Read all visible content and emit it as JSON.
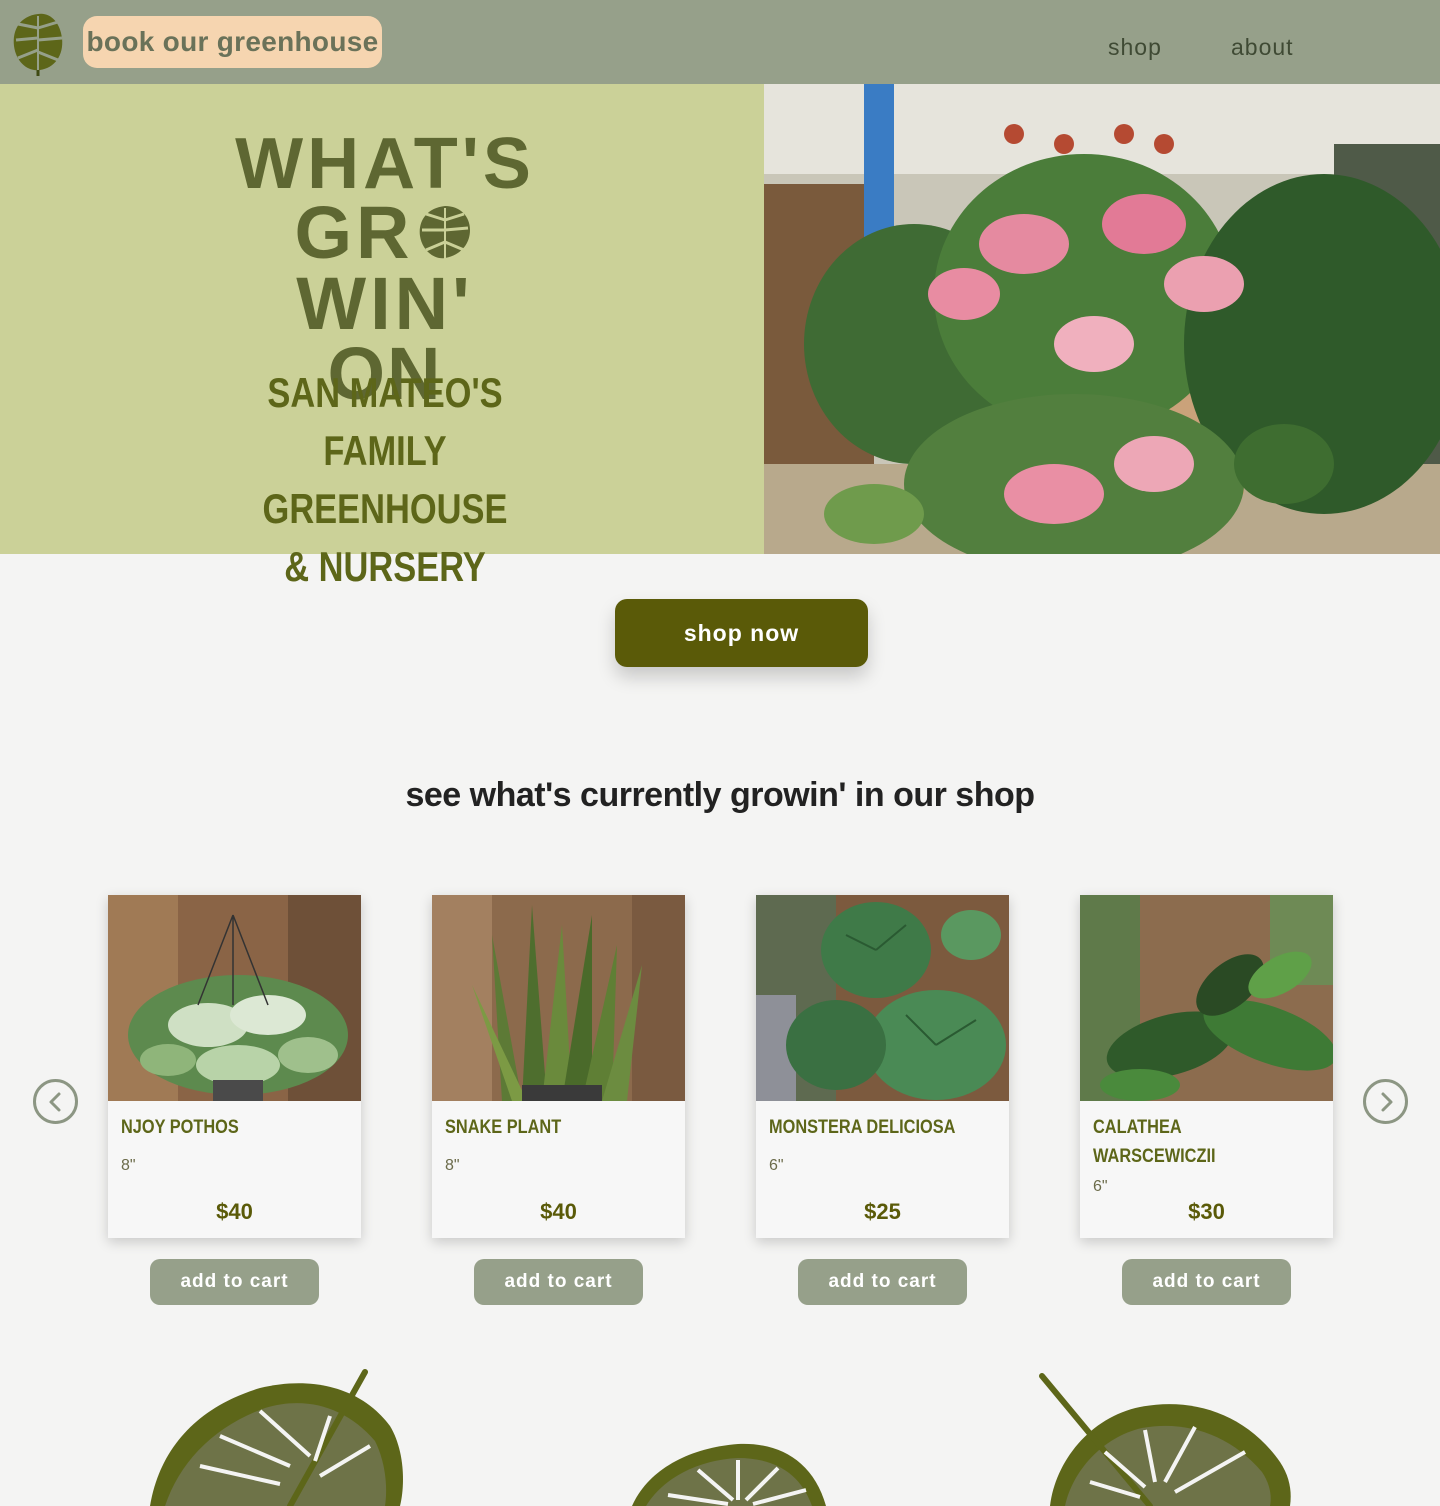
{
  "header": {
    "book_label": "book our greenhouse",
    "nav": [
      {
        "label": "shop"
      },
      {
        "label": "about"
      }
    ]
  },
  "hero": {
    "title_line1": "WHAT'S",
    "title_line2_part1": "GR",
    "title_line2_part2": "WIN'",
    "title_line3": "ON",
    "subtitle_line1": "SAN MATEO'S",
    "subtitle_line2": "FAMILY GREENHOUSE",
    "subtitle_line3": "& NURSERY"
  },
  "cta": {
    "shop_now_label": "shop now"
  },
  "shop": {
    "heading": "see what's currently growin' in our shop",
    "products": [
      {
        "name": "NJOY POTHOS",
        "size": "8\"",
        "price": "$40",
        "cart_label": "add to cart"
      },
      {
        "name": "SNAKE PLANT",
        "size": "8\"",
        "price": "$40",
        "cart_label": "add to cart"
      },
      {
        "name": "MONSTERA DELICIOSA",
        "size": "6\"",
        "price": "$25",
        "cart_label": "add to cart"
      },
      {
        "name": "CALATHEA WARSCEWICZII",
        "size": "6\"",
        "price": "$30",
        "cart_label": "add to cart"
      }
    ]
  },
  "colors": {
    "header_bg": "#96a08a",
    "hero_bg": "#cbd198",
    "brand_olive": "#5a5a08",
    "book_button_bg": "#f6d5b0"
  }
}
